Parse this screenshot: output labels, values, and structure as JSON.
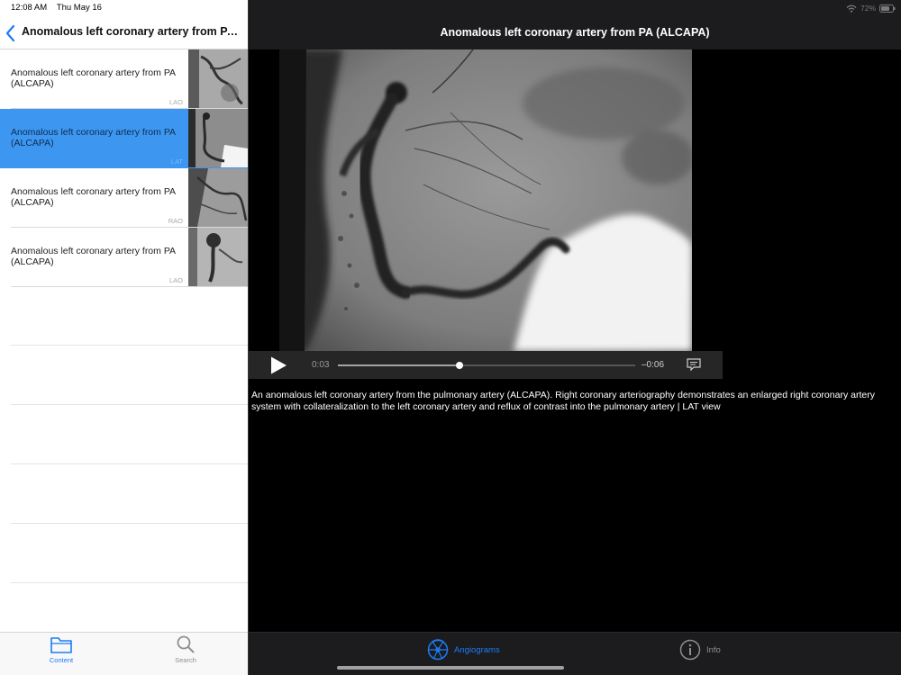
{
  "status": {
    "time": "12:08 AM",
    "date": "Thu May 16",
    "battery": "72%"
  },
  "nav": {
    "title": "Anomalous left coronary artery from PA..."
  },
  "list": {
    "items": [
      {
        "title": "Anomalous left coronary artery from PA (ALCAPA)",
        "view": "LAO",
        "selected": false
      },
      {
        "title": "Anomalous left coronary artery from PA (ALCAPA)",
        "view": "LAT",
        "selected": true
      },
      {
        "title": "Anomalous left coronary artery from PA (ALCAPA)",
        "view": "RAO",
        "selected": false
      },
      {
        "title": "Anomalous left coronary artery from PA (ALCAPA)",
        "view": "LAO",
        "selected": false
      }
    ]
  },
  "left_tabs": [
    {
      "label": "Content",
      "icon": "folder-icon",
      "active": true
    },
    {
      "label": "Search",
      "icon": "search-icon",
      "active": false
    }
  ],
  "detail": {
    "title": "Anomalous left coronary artery from PA (ALCAPA)",
    "caption": "An anomalous left coronary artery from the pulmonary artery (ALCAPA). Right coronary arteriography demonstrates an enlarged right coronary artery system with collateralization to the left coronary artery and reflux of contrast into the pulmonary artery | LAT view"
  },
  "player": {
    "elapsed": "0:03",
    "remaining": "–0:06",
    "progress": 0.41
  },
  "right_tabs": [
    {
      "label": "Angiograms",
      "icon": "angiogram-icon",
      "active": true
    },
    {
      "label": "Info",
      "icon": "info-icon",
      "active": false
    }
  ],
  "colors": {
    "accent": "#3d97f1",
    "tab_active": "#1a7cf5",
    "tab_inactive": "#8e8e93",
    "selected_row": "#3d97f1"
  }
}
